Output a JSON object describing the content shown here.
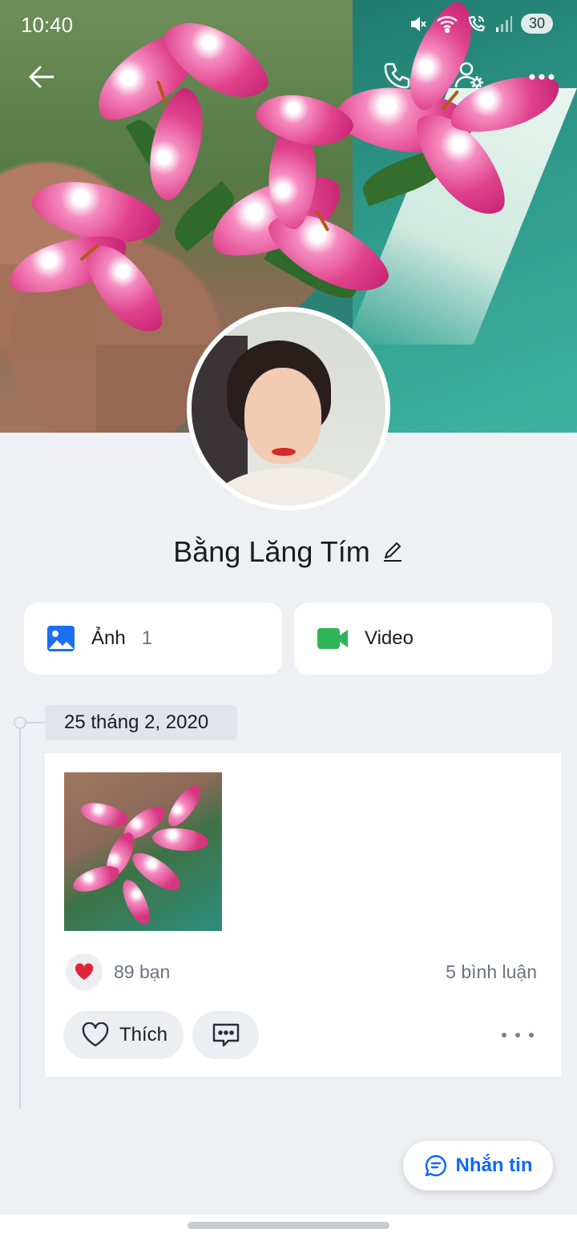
{
  "status_bar": {
    "time": "10:40",
    "battery": "30"
  },
  "header": {
    "back_icon": "arrow-left-icon",
    "call_icon": "phone-icon",
    "settings_icon": "user-gear-icon",
    "more_icon": "more-horizontal-icon"
  },
  "profile": {
    "name": "Bằng Lăng Tím"
  },
  "media": {
    "photos_label": "Ảnh",
    "photos_count": "1",
    "video_label": "Video"
  },
  "timeline": {
    "date": "25 tháng 2, 2020",
    "post": {
      "reaction_count": "89 bạn",
      "comment_count": "5 bình luận",
      "like_label": "Thích"
    }
  },
  "actions": {
    "message_label": "Nhắn tin"
  },
  "colors": {
    "accent": "#0a68ff",
    "photo_icon": "#1a6ff5",
    "video_icon": "#2fb559",
    "heart": "#e0253a",
    "background": "#eef0f4"
  }
}
